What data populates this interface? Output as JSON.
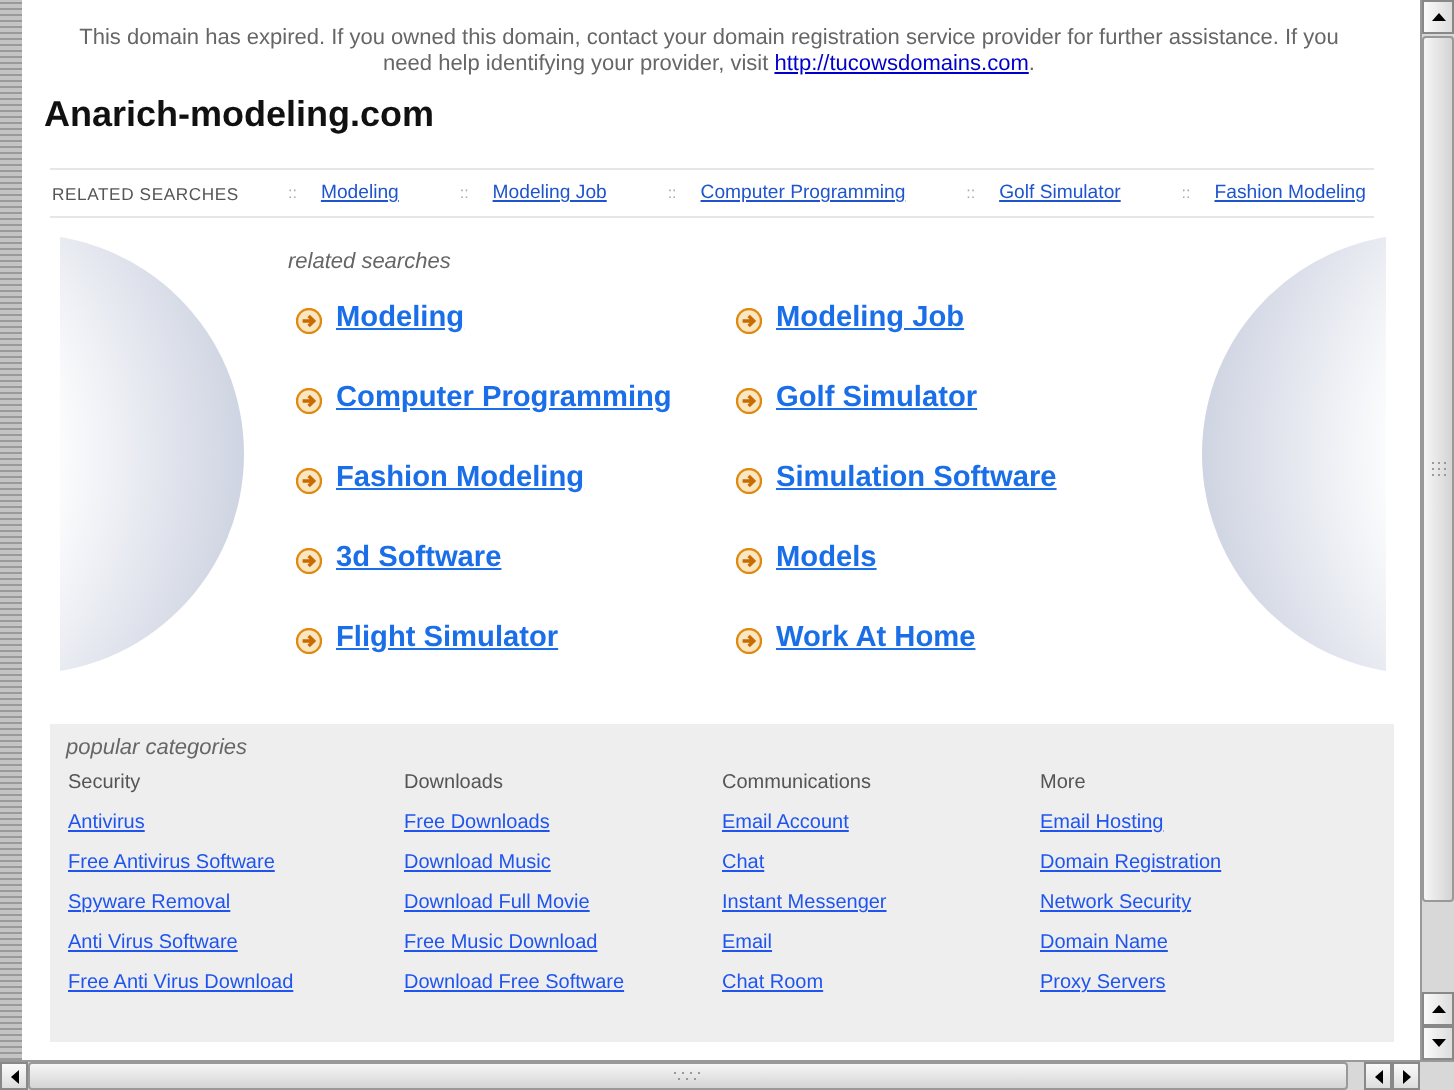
{
  "notice": {
    "text": "This domain has expired. If you owned this domain, contact your domain registration service provider for further assistance. If you need help identifying your provider, visit ",
    "link": "http://tucowsdomains.com",
    "after": "."
  },
  "site_title": "Anarich-modeling.com",
  "related_bar": {
    "label": "RELATED SEARCHES",
    "items": [
      {
        "separator": "::",
        "text": "Modeling"
      },
      {
        "separator": "::",
        "text": "Modeling Job"
      },
      {
        "separator": "::",
        "text": "Computer Programming"
      },
      {
        "separator": "::",
        "text": "Golf Simulator"
      },
      {
        "separator": "::",
        "text": "Fashion Modeling"
      }
    ]
  },
  "related_searches": {
    "heading": "related searches",
    "links": [
      "Modeling",
      "Modeling Job",
      "Computer Programming",
      "Golf Simulator",
      "Fashion Modeling",
      "Simulation Software",
      "3d Software",
      "Models",
      "Flight Simulator",
      "Work At Home"
    ]
  },
  "popular_categories": {
    "heading": "popular categories",
    "columns": [
      {
        "title": "Security",
        "links": [
          "Antivirus",
          "Free Antivirus Software",
          "Spyware Removal",
          "Anti Virus Software",
          "Free Anti Virus Download"
        ]
      },
      {
        "title": "Downloads",
        "links": [
          "Free Downloads",
          "Download Music",
          "Download Full Movie",
          "Free Music Download",
          "Download Free Software"
        ]
      },
      {
        "title": "Communications",
        "links": [
          "Email Account",
          "Chat",
          "Instant Messenger",
          "Email",
          "Chat Room"
        ]
      },
      {
        "title": "More",
        "links": [
          "Email Hosting",
          "Domain Registration",
          "Network Security",
          "Domain Name",
          "Proxy Servers"
        ]
      }
    ]
  }
}
